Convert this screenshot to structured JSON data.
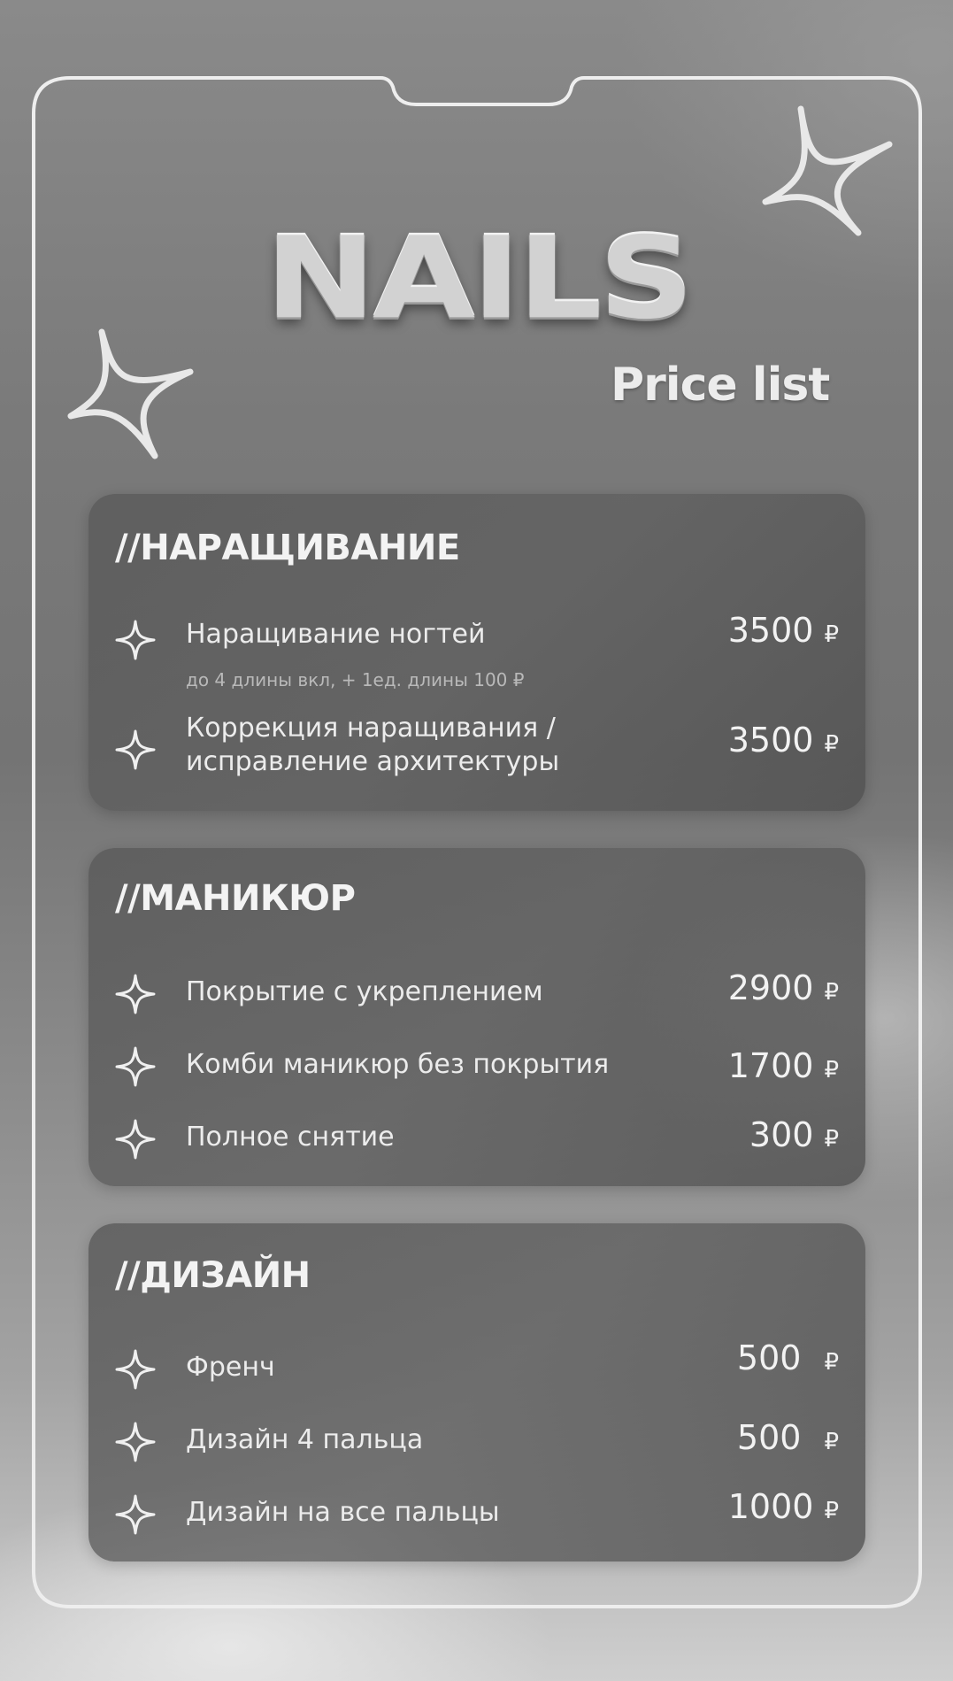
{
  "header": {
    "title": "NAILS",
    "subtitle": "Price list"
  },
  "sections": [
    {
      "title": "//НАРАЩИВАНИЕ",
      "items": [
        {
          "name": "Наращивание ногтей",
          "price": "3500",
          "currency": "₽",
          "note": "до 4 длины вкл, + 1ед. длины 100 ₽"
        },
        {
          "name_line1": "Коррекция наращивания /",
          "name_line2": "исправление архитектуры",
          "price": "3500",
          "currency": "₽"
        }
      ]
    },
    {
      "title": "//МАНИКЮР",
      "items": [
        {
          "name": "Покрытие с укреплением",
          "price": "2900",
          "currency": "₽"
        },
        {
          "name": "Комби маникюр без покрытия",
          "price": "1700",
          "currency": "₽"
        },
        {
          "name": "Полное снятие",
          "price": "300",
          "currency": "₽"
        }
      ]
    },
    {
      "title": "//ДИЗАЙН",
      "items": [
        {
          "name": "Френч",
          "price": "500",
          "currency": "₽"
        },
        {
          "name": "Дизайн 4 пальца",
          "price": "500",
          "currency": "₽"
        },
        {
          "name": "Дизайн на все пальцы",
          "price": "1000",
          "currency": "₽"
        }
      ]
    }
  ],
  "icons": {
    "bullet": "sparkle-star-icon",
    "decor": "four-point-star-outline-icon"
  },
  "colors": {
    "text": "#f2f2f2",
    "card": "#5e5e5e",
    "frame": "#eeeeee"
  }
}
